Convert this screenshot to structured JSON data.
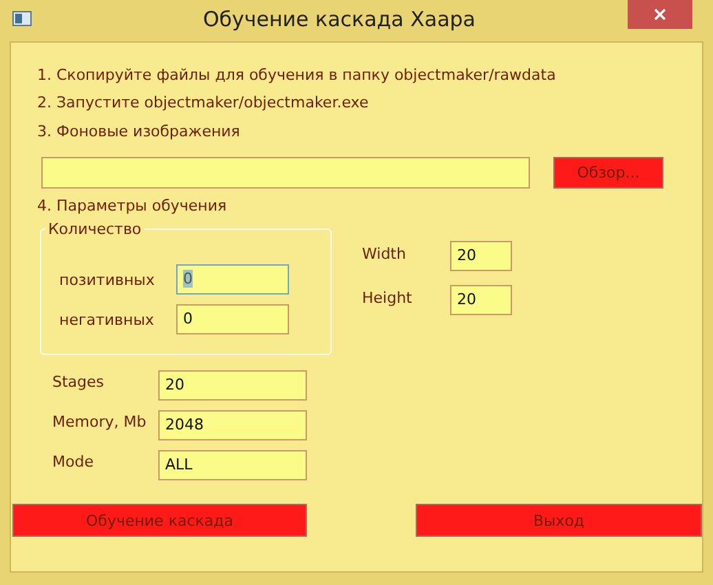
{
  "window": {
    "title": "Обучение каскада Хаара"
  },
  "steps": [
    "1. Скопируйте файлы для обучения в папку objectmaker/rawdata",
    "2. Запустите objectmaker/objectmaker.exe",
    "3. Фоновые изображения"
  ],
  "browse_button": "Обзор...",
  "params_heading": "4. Параметры обучения",
  "count_group": {
    "title": "Количество",
    "fields": [
      {
        "label": "позитивных",
        "value": "0",
        "focused": true
      },
      {
        "label": "негативных",
        "value": "0",
        "focused": false
      }
    ]
  },
  "size_fields": [
    {
      "label": "Width",
      "value": "20",
      "focused": false
    },
    {
      "label": "Height",
      "value": "20",
      "focused": false
    }
  ],
  "training_fields": [
    {
      "label": "Stages",
      "value": "20",
      "focused": false
    },
    {
      "label": "Memory, Mb",
      "value": "2048",
      "focused": false
    },
    {
      "label": "Mode",
      "value": "ALL",
      "focused": false
    }
  ],
  "buttons": [
    "Обучение каскада",
    "Выход"
  ]
}
